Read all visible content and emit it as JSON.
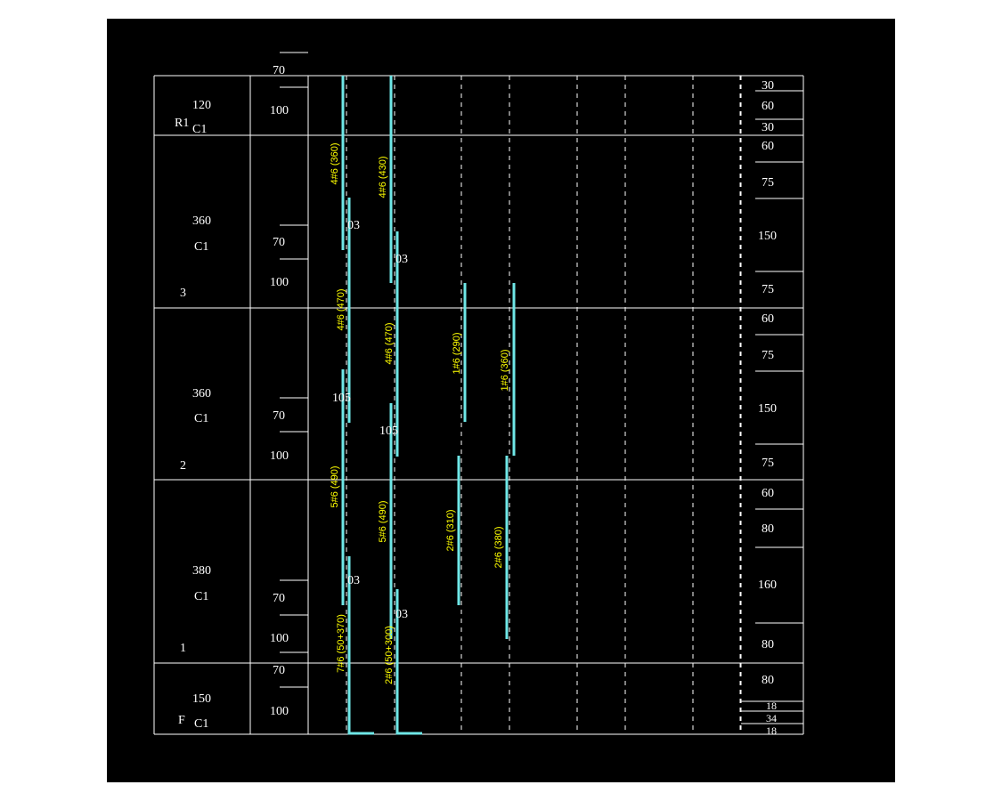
{
  "colors": {
    "background": "#000000",
    "lines": "#ffffff",
    "bars": "#6fe7e7",
    "bar_labels": "#ffff00"
  },
  "floors": [
    {
      "id": "R1",
      "label": "R1",
      "height": "120",
      "col": "C1"
    },
    {
      "id": "3",
      "label": "3",
      "height": "360",
      "col": "C1"
    },
    {
      "id": "2",
      "label": "2",
      "height": "360",
      "col": "C1"
    },
    {
      "id": "1",
      "label": "1",
      "height": "380",
      "col": "C1"
    },
    {
      "id": "F",
      "label": "F",
      "height": "150",
      "col": "C1"
    }
  ],
  "splice_zone_marks": [
    "70",
    "100",
    "70",
    "100",
    "70",
    "100",
    "70",
    "100",
    "70",
    "100"
  ],
  "lap_marks": [
    "03",
    "03",
    "105",
    "105",
    "03",
    "03"
  ],
  "rebar_labels": [
    "4#6 (360)",
    "4#6 (430)",
    "4#6 (470)",
    "4#6 (470)",
    "1#6 (290)",
    "1#6 (360)",
    "5#6 (490)",
    "5#6 (490)",
    "2#6 (310)",
    "2#6 (380)",
    "7#6 (50+370)",
    "2#6 (50+300)"
  ],
  "right_dims": [
    "30",
    "60",
    "30",
    "60",
    "75",
    "150",
    "75",
    "60",
    "75",
    "150",
    "75",
    "60",
    "80",
    "160",
    "80",
    "80",
    "18",
    "34",
    "18"
  ]
}
